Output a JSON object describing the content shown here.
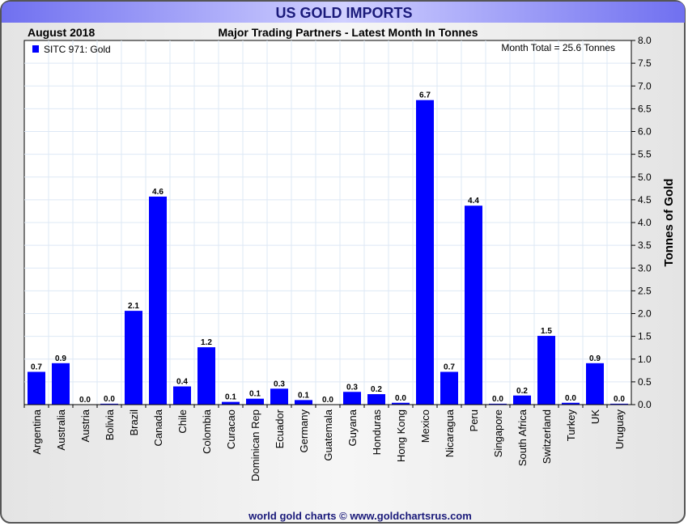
{
  "chart_data": {
    "type": "bar",
    "title": "US GOLD IMPORTS",
    "subtitle": "Major Trading Partners - Latest Month In Tonnes",
    "period": "August 2018",
    "legend": "SITC 971: Gold",
    "legend_placement": "top-left",
    "annotation": "Month Total = 25.6 Tonnes",
    "ylabel": "Tonnes of Gold",
    "xlabel": "",
    "ylim": [
      0,
      8
    ],
    "yticks": [
      "0.0",
      "0.5",
      "1.0",
      "1.5",
      "2.0",
      "2.5",
      "3.0",
      "3.5",
      "4.0",
      "4.5",
      "5.0",
      "5.5",
      "6.0",
      "6.5",
      "7.0",
      "7.5",
      "8.0"
    ],
    "grid": true,
    "categories": [
      "Argentina",
      "Australia",
      "Austria",
      "Bolivia",
      "Brazil",
      "Canada",
      "Chile",
      "Colombia",
      "Curacao",
      "Dominican Rep",
      "Ecuador",
      "Germany",
      "Guatemala",
      "Guyana",
      "Honduras",
      "Hong Kong",
      "Mexico",
      "Nicaragua",
      "Peru",
      "Singapore",
      "South Africa",
      "Switzerland",
      "Turkey",
      "UK",
      "Uruguay"
    ],
    "values": [
      0.72,
      0.91,
      0.0,
      0.02,
      2.06,
      4.57,
      0.4,
      1.26,
      0.06,
      0.13,
      0.35,
      0.1,
      0.0,
      0.28,
      0.23,
      0.04,
      6.69,
      0.72,
      4.37,
      0.02,
      0.2,
      1.51,
      0.04,
      0.91,
      0.02
    ],
    "labels": [
      "0.7",
      "0.9",
      "0.0",
      "0.0",
      "2.1",
      "4.6",
      "0.4",
      "1.2",
      "0.1",
      "0.1",
      "0.3",
      "0.1",
      "0.0",
      "0.3",
      "0.2",
      "0.0",
      "6.7",
      "0.7",
      "4.4",
      "0.0",
      "0.2",
      "1.5",
      "0.0",
      "0.9",
      "0.0"
    ],
    "series_color": "#0000ff"
  },
  "footer": "world gold charts © www.goldchartsrus.com"
}
